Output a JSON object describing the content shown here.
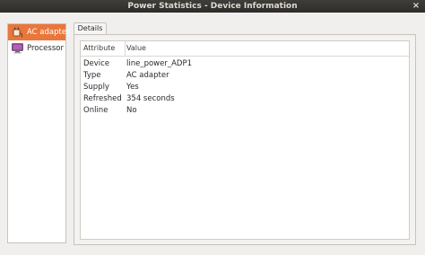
{
  "window": {
    "title": "Power Statistics - Device Information",
    "close_glyph": "×"
  },
  "sidebar": {
    "items": [
      {
        "label": "AC adapter",
        "icon": "ac-adapter-icon",
        "selected": true
      },
      {
        "label": "Processor",
        "icon": "processor-icon",
        "selected": false
      }
    ]
  },
  "tabs": [
    {
      "label": "Details",
      "active": true
    }
  ],
  "table": {
    "headers": {
      "attribute": "Attribute",
      "value": "Value"
    },
    "rows": [
      {
        "attribute": "Device",
        "value": "line_power_ADP1"
      },
      {
        "attribute": "Type",
        "value": "AC adapter"
      },
      {
        "attribute": "Supply",
        "value": "Yes"
      },
      {
        "attribute": "Refreshed",
        "value": "354 seconds"
      },
      {
        "attribute": "Online",
        "value": "No"
      }
    ]
  },
  "colors": {
    "accent": "#e9763b",
    "titlebar": "#2d2c29"
  }
}
